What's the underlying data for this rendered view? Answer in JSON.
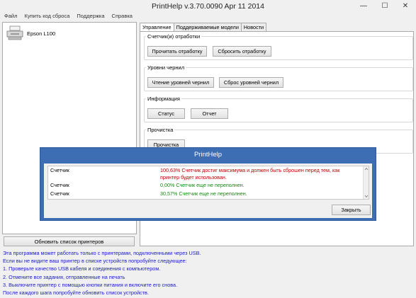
{
  "window": {
    "title": "PrintHelp v.3.70.0090 Apr 11 2014",
    "controls": {
      "minimize": "—",
      "maximize": "☐",
      "close": "✕"
    }
  },
  "menu": [
    "Файл",
    "Купить код сброса",
    "Поддержка",
    "Справка"
  ],
  "printers": {
    "items": [
      {
        "name": "Epson L100",
        "icon": "printer-icon"
      }
    ],
    "refresh_label": "Обновить список принтеров"
  },
  "tabs": [
    {
      "label": "Управление",
      "active": true
    },
    {
      "label": "Поддерживаемые модели",
      "active": false
    },
    {
      "label": "Новости",
      "active": false
    }
  ],
  "groups": {
    "counters": {
      "legend": "Счетчик(и) отработки",
      "read": "Прочитать отработку",
      "reset": "Сбросить отработку"
    },
    "ink": {
      "legend": "Уровни чернил",
      "read": "Чтение уровней чернил",
      "reset": "Сброс уровней чернил"
    },
    "info": {
      "legend": "Информация",
      "status": "Статус",
      "report": "Отчет"
    },
    "clean": {
      "legend": "Прочистка",
      "clean": "Прочистка"
    }
  },
  "info_text": [
    "Эта программа может работать только с принтерами, подключенными через USB.",
    "Если вы не видите ваш принтер в списке устройств попробуйте следующее:",
    "1. Проверьте качество USB кабеля и соединения с компьютером.",
    "2. Отмените все задания, отправленные на печать",
    "3. Выключите принтер с помощью кнопки питания и включите его снова.",
    "После каждого шага попробуйте обновить список устройств."
  ],
  "dialog": {
    "title": "PrintHelp",
    "messages": [
      {
        "name": "Счетчик",
        "text": "100,63% Счетчик достиг максимума и должен быть сброшен перед тем, как принтер будет использован.",
        "color": "#c00000"
      },
      {
        "name": "Счетчик",
        "text": "0,00% Счетчик еще не переполнен.",
        "color": "#128a12"
      },
      {
        "name": "Счетчик",
        "text": "30,57% Счетчик еще не переполнен.",
        "color": "#128a12"
      }
    ],
    "close_label": "Закрыть"
  }
}
